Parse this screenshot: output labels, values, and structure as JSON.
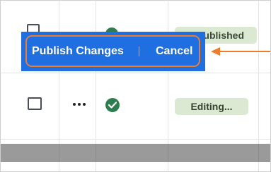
{
  "top_row": {
    "status_badge": "Published"
  },
  "publish_bar": {
    "publish_label": "Publish Changes",
    "cancel_label": "Cancel",
    "separator": "|"
  },
  "row": {
    "more_icon": "ellipsis-icon",
    "status_icon": "check-circle-icon",
    "status_badge": "Editing..."
  },
  "colors": {
    "bar": "#1f6fe0",
    "annotation": "#f07b28",
    "badge_bg": "#dbe9d3",
    "check_green": "#2e7d4f"
  }
}
